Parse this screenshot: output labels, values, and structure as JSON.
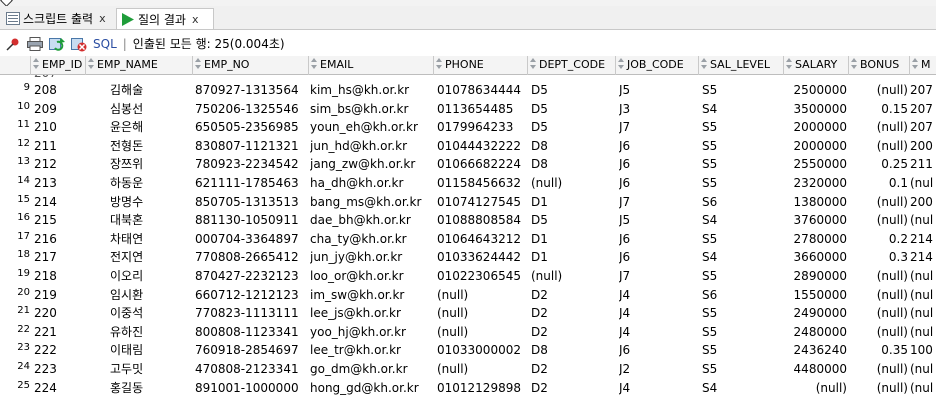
{
  "tabs": [
    {
      "label": "스크립트 출력",
      "close": "x"
    },
    {
      "label": "질의 결과",
      "close": "x"
    }
  ],
  "toolbar": {
    "sql_label": "SQL",
    "separator": "|",
    "status": "인출된 모든 행: 25(0.004초)"
  },
  "grid": {
    "columns": [
      "EMP_ID",
      "EMP_NAME",
      "EMP_NO",
      "EMAIL",
      "PHONE",
      "DEPT_CODE",
      "JOB_CODE",
      "SAL_LEVEL",
      "SALARY",
      "BONUS",
      "M"
    ],
    "partial_row": [
      "207",
      "",
      "",
      "",
      "",
      "",
      "",
      "",
      "",
      "",
      ""
    ],
    "rows": [
      [
        "9",
        "208",
        "김해술",
        "870927-1313564",
        "kim_hs@kh.or.kr",
        "01078634444",
        "D5",
        "J5",
        "S5",
        "2500000",
        "(null)",
        "207"
      ],
      [
        "10",
        "209",
        "심봉선",
        "750206-1325546",
        "sim_bs@kh.or.kr",
        "0113654485",
        "D5",
        "J3",
        "S4",
        "3500000",
        "0.15",
        "207"
      ],
      [
        "11",
        "210",
        "윤은해",
        "650505-2356985",
        "youn_eh@kh.or.kr",
        "0179964233",
        "D5",
        "J7",
        "S5",
        "2000000",
        "(null)",
        "207"
      ],
      [
        "12",
        "211",
        "전형돈",
        "830807-1121321",
        "jun_hd@kh.or.kr",
        "01044432222",
        "D8",
        "J6",
        "S5",
        "2000000",
        "(null)",
        "200"
      ],
      [
        "13",
        "212",
        "장쯔위",
        "780923-2234542",
        "jang_zw@kh.or.kr",
        "01066682224",
        "D8",
        "J6",
        "S5",
        "2550000",
        "0.25",
        "211"
      ],
      [
        "14",
        "213",
        "하동운",
        "621111-1785463",
        "ha_dh@kh.or.kr",
        "01158456632",
        "(null)",
        "J6",
        "S5",
        "2320000",
        "0.1",
        "(nul"
      ],
      [
        "15",
        "214",
        "방명수",
        "850705-1313513",
        "bang_ms@kh.or.kr",
        "01074127545",
        "D1",
        "J7",
        "S6",
        "1380000",
        "(null)",
        "200"
      ],
      [
        "16",
        "215",
        "대북혼",
        "881130-1050911",
        "dae_bh@kh.or.kr",
        "01088808584",
        "D5",
        "J5",
        "S4",
        "3760000",
        "(null)",
        "(nul"
      ],
      [
        "17",
        "216",
        "차태연",
        "000704-3364897",
        "cha_ty@kh.or.kr",
        "01064643212",
        "D1",
        "J6",
        "S5",
        "2780000",
        "0.2",
        "214"
      ],
      [
        "18",
        "217",
        "전지연",
        "770808-2665412",
        "jun_jy@kh.or.kr",
        "01033624442",
        "D1",
        "J6",
        "S4",
        "3660000",
        "0.3",
        "214"
      ],
      [
        "19",
        "218",
        "이오리",
        "870427-2232123",
        "loo_or@kh.or.kr",
        "01022306545",
        "(null)",
        "J7",
        "S5",
        "2890000",
        "(null)",
        "(nul"
      ],
      [
        "20",
        "219",
        "임시환",
        "660712-1212123",
        "im_sw@kh.or.kr",
        "(null)",
        "D2",
        "J4",
        "S6",
        "1550000",
        "(null)",
        "(nul"
      ],
      [
        "21",
        "220",
        "이중석",
        "770823-1113111",
        "lee_js@kh.or.kr",
        "(null)",
        "D2",
        "J4",
        "S5",
        "2490000",
        "(null)",
        "(nul"
      ],
      [
        "22",
        "221",
        "유하진",
        "800808-1123341",
        "yoo_hj@kh.or.kr",
        "(null)",
        "D2",
        "J4",
        "S5",
        "2480000",
        "(null)",
        "(nul"
      ],
      [
        "23",
        "222",
        "이태림",
        "760918-2854697",
        "lee_tr@kh.or.kr",
        "01033000002",
        "D8",
        "J6",
        "S5",
        "2436240",
        "0.35",
        "100"
      ],
      [
        "24",
        "223",
        "고두밋",
        "470808-2123341",
        "go_dm@kh.or.kr",
        "(null)",
        "D2",
        "J2",
        "S5",
        "4480000",
        "(null)",
        "(nul"
      ],
      [
        "25",
        "224",
        "홍길동",
        "891001-1000000",
        "hong_gd@kh.or.kr",
        "01012129898",
        "D2",
        "J4",
        "S4",
        "(null)",
        "(null)",
        "(nul"
      ]
    ]
  },
  "colors": {
    "play_green": "#1f9d3a",
    "sql_blue": "#2b4ea2",
    "header_bg": "#f4f4f4",
    "tab_bg": "#f0f0f0"
  }
}
